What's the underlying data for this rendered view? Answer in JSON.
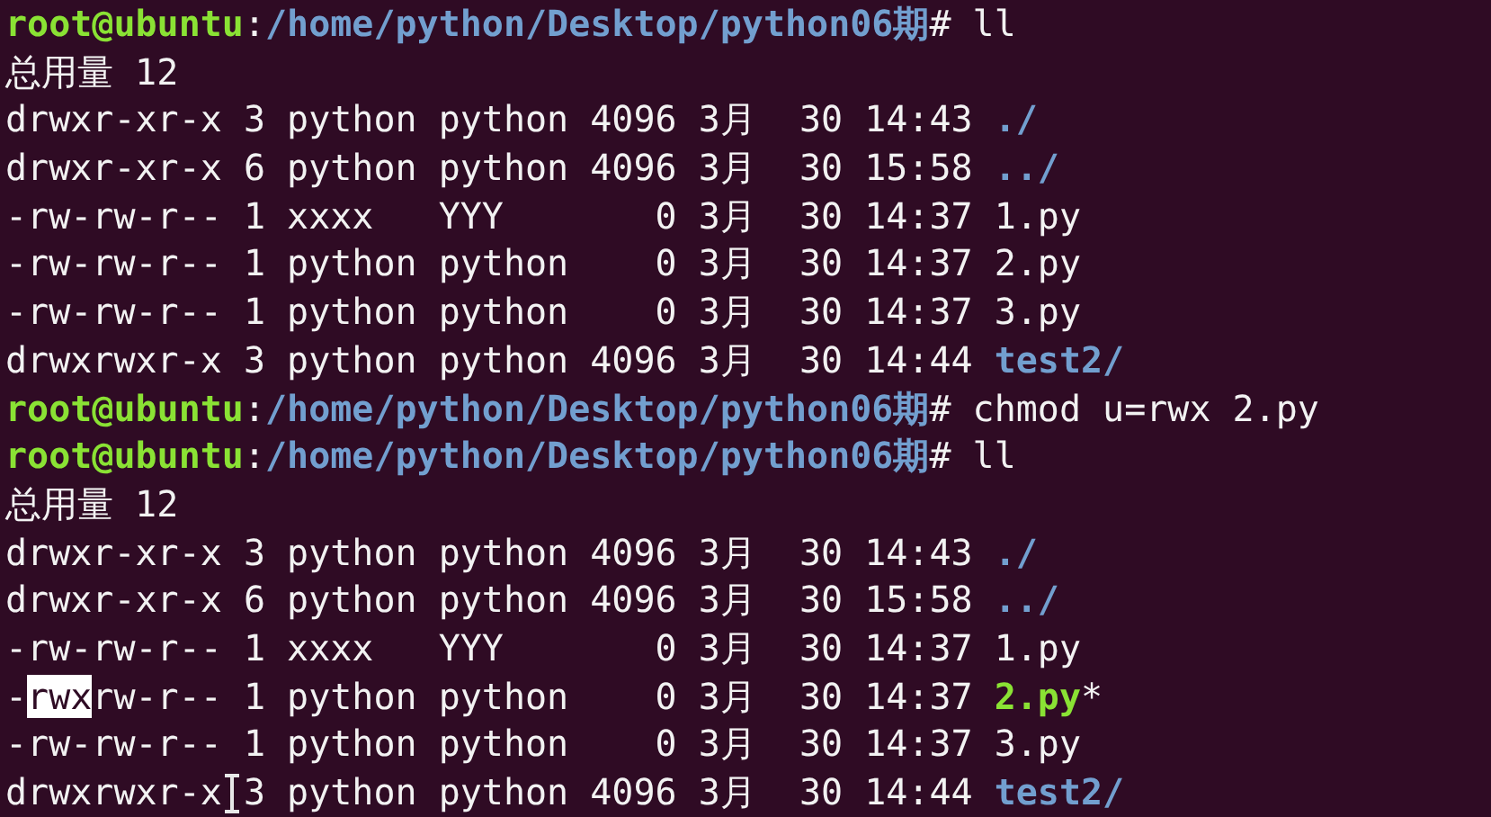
{
  "terminal": {
    "lines": [
      {
        "kind": "prompt",
        "user_host": "root@ubuntu",
        "separator": ":",
        "path": "/home/python/Desktop/python06期",
        "symbol": "#",
        "command": "ll"
      },
      {
        "kind": "text",
        "text": "总用量 12"
      },
      {
        "kind": "entry",
        "perms": [
          {
            "text": "drwxr-xr-x",
            "selected": false
          }
        ],
        "info": "3 python python 4096 3月  30 14:43",
        "file": {
          "name": "./",
          "kind": "dir"
        }
      },
      {
        "kind": "entry",
        "perms": [
          {
            "text": "drwxr-xr-x",
            "selected": false
          }
        ],
        "info": "6 python python 4096 3月  30 15:58",
        "file": {
          "name": "../",
          "kind": "dir"
        }
      },
      {
        "kind": "entry",
        "perms": [
          {
            "text": "-rw-rw-r--",
            "selected": false
          }
        ],
        "info": "1 xxxx   YYY       0 3月  30 14:37",
        "file": {
          "name": "1.py",
          "kind": "plain"
        }
      },
      {
        "kind": "entry",
        "perms": [
          {
            "text": "-rw-rw-r--",
            "selected": false
          }
        ],
        "info": "1 python python    0 3月  30 14:37",
        "file": {
          "name": "2.py",
          "kind": "plain"
        }
      },
      {
        "kind": "entry",
        "perms": [
          {
            "text": "-rw-rw-r--",
            "selected": false
          }
        ],
        "info": "1 python python    0 3月  30 14:37",
        "file": {
          "name": "3.py",
          "kind": "plain"
        }
      },
      {
        "kind": "entry",
        "perms": [
          {
            "text": "drwxrwxr-x",
            "selected": false
          }
        ],
        "info": "3 python python 4096 3月  30 14:44",
        "file": {
          "name": "test2/",
          "kind": "dir"
        }
      },
      {
        "kind": "prompt",
        "user_host": "root@ubuntu",
        "separator": ":",
        "path": "/home/python/Desktop/python06期",
        "symbol": "#",
        "command": "chmod u=rwx 2.py"
      },
      {
        "kind": "prompt",
        "user_host": "root@ubuntu",
        "separator": ":",
        "path": "/home/python/Desktop/python06期",
        "symbol": "#",
        "command": "ll"
      },
      {
        "kind": "text",
        "text": "总用量 12"
      },
      {
        "kind": "entry",
        "perms": [
          {
            "text": "drwxr-xr-x",
            "selected": false
          }
        ],
        "info": "3 python python 4096 3月  30 14:43",
        "file": {
          "name": "./",
          "kind": "dir"
        }
      },
      {
        "kind": "entry",
        "perms": [
          {
            "text": "drwxr-xr-x",
            "selected": false
          }
        ],
        "info": "6 python python 4096 3月  30 15:58",
        "file": {
          "name": "../",
          "kind": "dir"
        }
      },
      {
        "kind": "entry",
        "perms": [
          {
            "text": "-rw-rw-r--",
            "selected": false
          }
        ],
        "info": "1 xxxx   YYY       0 3月  30 14:37",
        "file": {
          "name": "1.py",
          "kind": "plain"
        }
      },
      {
        "kind": "entry",
        "perms": [
          {
            "text": "-",
            "selected": false
          },
          {
            "text": "rwx",
            "selected": true
          },
          {
            "text": "rw-r--",
            "selected": false
          }
        ],
        "info": "1 python python    0 3月  30 14:37",
        "file": {
          "name": "2.py",
          "kind": "exec",
          "suffix": "*"
        }
      },
      {
        "kind": "entry",
        "perms": [
          {
            "text": "-rw-rw-r--",
            "selected": false
          }
        ],
        "info": "1 python python    0 3月  30 14:37",
        "file": {
          "name": "3.py",
          "kind": "plain"
        }
      },
      {
        "kind": "entry",
        "perms": [
          {
            "text": "drwxrwxr-x",
            "selected": false
          }
        ],
        "info": "3 python python 4096 3月  30 14:44",
        "file": {
          "name": "test2/",
          "kind": "dir"
        }
      }
    ]
  }
}
